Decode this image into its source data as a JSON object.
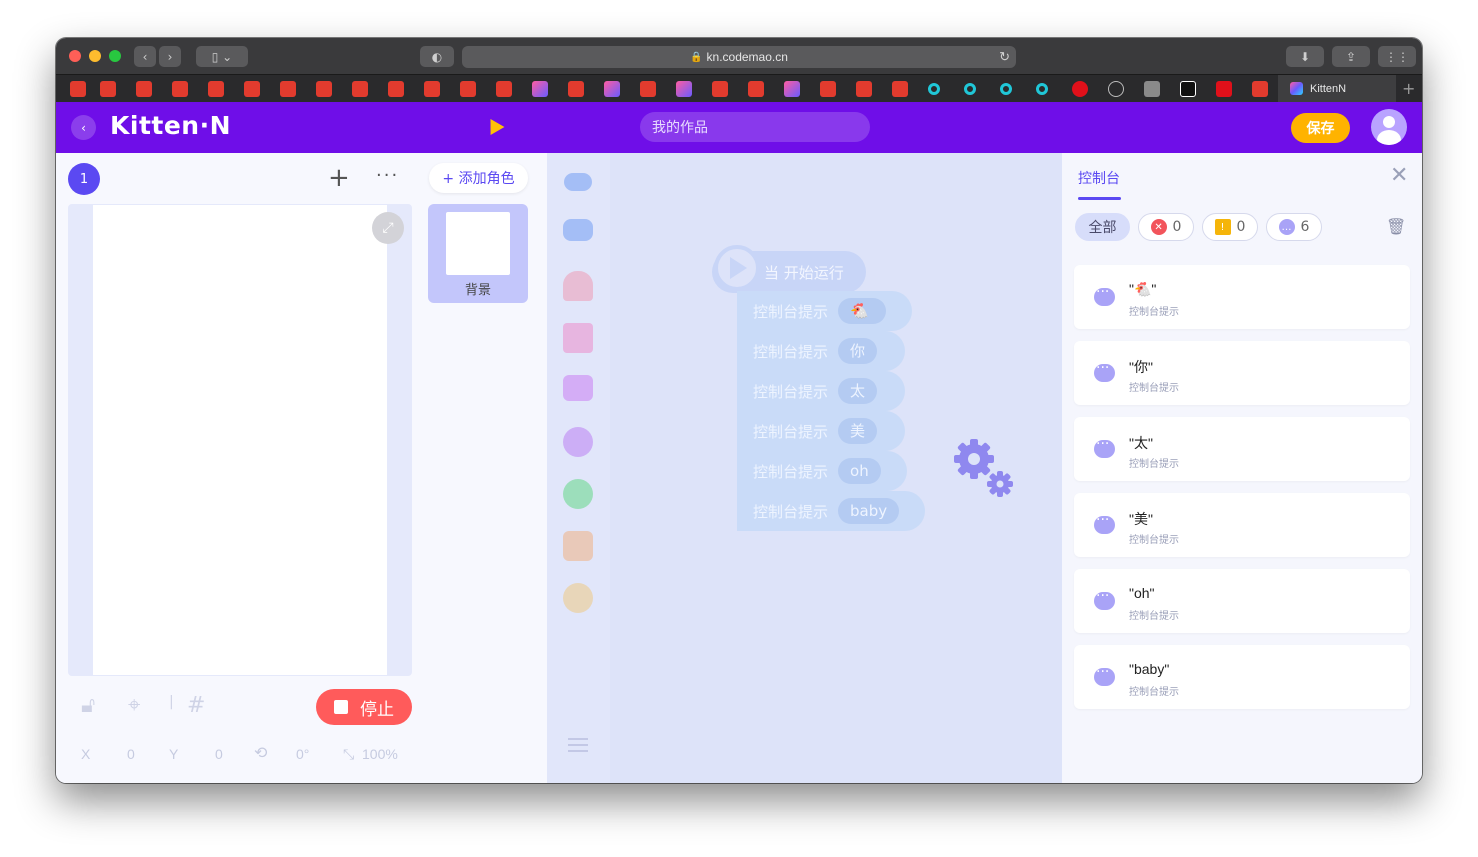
{
  "browser": {
    "url": "kn.codemao.cn",
    "active_tab_title": "KittenN"
  },
  "header": {
    "logo": "Kitten·N",
    "project_placeholder": "我的作品",
    "save_label": "保存"
  },
  "stage": {
    "scene_number": "1",
    "add_role_label": "+ 添加角色",
    "background_label": "背景",
    "stop_label": "停止",
    "coords": {
      "x_label": "X",
      "x_value": "0",
      "y_label": "Y",
      "y_value": "0",
      "rotation": "0°",
      "scale": "100%"
    }
  },
  "code": {
    "hat_label": "当 开始运行",
    "blocks": [
      {
        "label": "控制台提示",
        "arg": ""
      },
      {
        "label": "控制台提示",
        "arg": "你"
      },
      {
        "label": "控制台提示",
        "arg": "太"
      },
      {
        "label": "控制台提示",
        "arg": "美"
      },
      {
        "label": "控制台提示",
        "arg": "oh"
      },
      {
        "label": "控制台提示",
        "arg": "baby"
      }
    ]
  },
  "console": {
    "title": "控制台",
    "filters": {
      "all_label": "全部",
      "error_count": "0",
      "warning_count": "0",
      "message_count": "6"
    },
    "logs": [
      {
        "text": "\"🐔\"",
        "sub": "控制台提示"
      },
      {
        "text": "\"你\"",
        "sub": "控制台提示"
      },
      {
        "text": "\"太\"",
        "sub": "控制台提示"
      },
      {
        "text": "\"美\"",
        "sub": "控制台提示"
      },
      {
        "text": "\"oh\"",
        "sub": "控制台提示"
      },
      {
        "text": "\"baby\"",
        "sub": "控制台提示"
      }
    ]
  },
  "colors": {
    "header": "#6f0ee8",
    "accent": "#5b49f2",
    "save": "#ffb300",
    "stop": "#ff5b5b"
  }
}
